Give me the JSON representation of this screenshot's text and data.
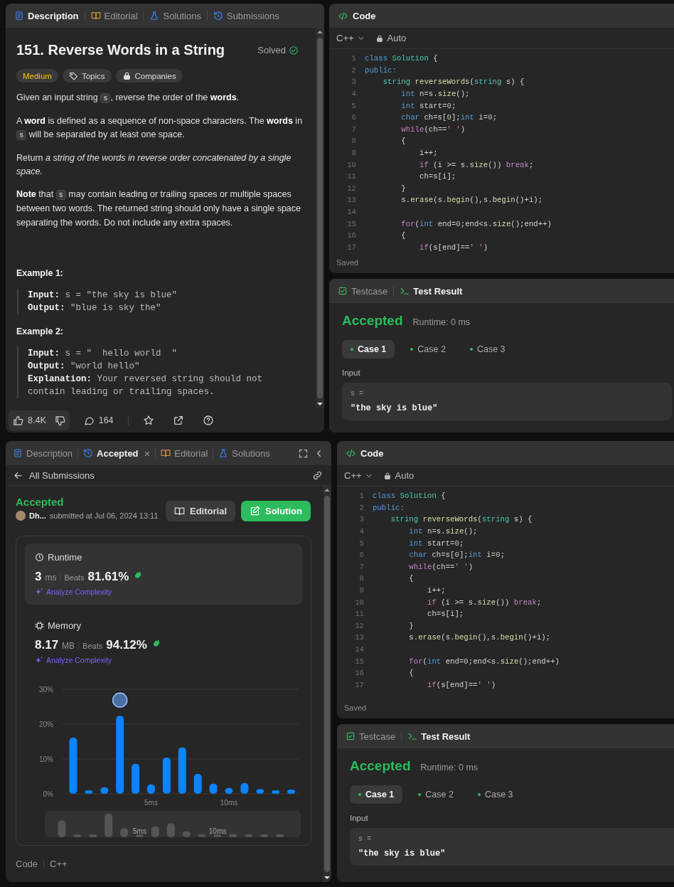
{
  "top": {
    "description_panel": {
      "tabs": [
        {
          "kind": "description",
          "label": "Description",
          "selected": true
        },
        {
          "kind": "editorial",
          "label": "Editorial",
          "selected": false
        },
        {
          "kind": "solutions",
          "label": "Solutions",
          "selected": false
        },
        {
          "kind": "submissions",
          "label": "Submissions",
          "selected": false
        }
      ],
      "title": "151. Reverse Words in a String",
      "status": "Solved",
      "tags": [
        {
          "kind": "difficulty",
          "label": "Medium"
        },
        {
          "kind": "topics",
          "label": "Topics"
        },
        {
          "kind": "companies",
          "label": "Companies"
        }
      ],
      "paragraphs": [
        [
          {
            "kind": "text",
            "text": "Given an input string "
          },
          {
            "kind": "code",
            "text": "s"
          },
          {
            "kind": "text",
            "text": ", reverse the order of the **words**."
          }
        ],
        [
          {
            "kind": "text",
            "text": "A **word** is defined as a sequence of non-space characters. The **words** in "
          },
          {
            "kind": "code",
            "text": "s"
          },
          {
            "kind": "text",
            "text": " will be separated by at least one space."
          }
        ],
        [
          {
            "kind": "text",
            "text": "Return *a string of the words in reverse order concatenated by a single space.*"
          }
        ],
        [
          {
            "kind": "text",
            "text": "**Note** that "
          },
          {
            "kind": "code",
            "text": "s"
          },
          {
            "kind": "text",
            "text": " may contain leading or trailing spaces or multiple spaces between two words. The returned string should only have a single space separating the words. Do not include any extra spaces."
          }
        ]
      ],
      "examples": [
        {
          "title": "Example 1:",
          "lines": [
            "**Input:** s = \"the sky is blue\"",
            "**Output:** \"blue is sky the\""
          ]
        },
        {
          "title": "Example 2:",
          "lines": [
            "**Input:** s = \"  hello world  \"",
            "**Output:** \"world hello\"",
            "**Explanation:** Your reversed string should not contain leading or trailing spaces."
          ]
        }
      ],
      "likes": "8.4K",
      "comments": "164"
    },
    "code_panel": {
      "title": "Code",
      "language": "C++",
      "mode": "Auto",
      "status": "Saved",
      "lines": [
        {
          "n": "1",
          "tokens": [
            {
              "kind": "keyword",
              "text": "class "
            },
            {
              "kind": "type",
              "text": "Solution"
            },
            {
              "kind": "plain",
              "text": " {"
            }
          ]
        },
        {
          "n": "2",
          "tokens": [
            {
              "kind": "keyword",
              "text": "public:"
            }
          ]
        },
        {
          "n": "3",
          "tokens": [
            {
              "kind": "type",
              "text": "    string "
            },
            {
              "kind": "function",
              "text": "reverseWords"
            },
            {
              "kind": "plain",
              "text": "("
            },
            {
              "kind": "type",
              "text": "string"
            },
            {
              "kind": "plain",
              "text": " s) {"
            }
          ]
        },
        {
          "n": "4",
          "tokens": [
            {
              "kind": "keyword",
              "text": "        int"
            },
            {
              "kind": "plain",
              "text": " n=s."
            },
            {
              "kind": "function",
              "text": "size"
            },
            {
              "kind": "plain",
              "text": "();"
            }
          ]
        },
        {
          "n": "5",
          "tokens": [
            {
              "kind": "keyword",
              "text": "        int"
            },
            {
              "kind": "plain",
              "text": " start="
            },
            {
              "kind": "number",
              "text": "0"
            },
            {
              "kind": "plain",
              "text": ";"
            }
          ]
        },
        {
          "n": "6",
          "tokens": [
            {
              "kind": "keyword",
              "text": "        char"
            },
            {
              "kind": "plain",
              "text": " ch=s["
            },
            {
              "kind": "number",
              "text": "0"
            },
            {
              "kind": "plain",
              "text": "];"
            },
            {
              "kind": "keyword",
              "text": "int"
            },
            {
              "kind": "plain",
              "text": " i="
            },
            {
              "kind": "number",
              "text": "0"
            },
            {
              "kind": "plain",
              "text": ";"
            }
          ]
        },
        {
          "n": "7",
          "tokens": [
            {
              "kind": "control",
              "text": "        while"
            },
            {
              "kind": "plain",
              "text": "(ch=="
            },
            {
              "kind": "string",
              "text": "' '"
            },
            {
              "kind": "plain",
              "text": ")"
            }
          ]
        },
        {
          "n": "8",
          "tokens": [
            {
              "kind": "plain",
              "text": "        {"
            }
          ]
        },
        {
          "n": "9",
          "tokens": [
            {
              "kind": "plain",
              "text": "            i++;"
            }
          ]
        },
        {
          "n": "10",
          "tokens": [
            {
              "kind": "control",
              "text": "            if"
            },
            {
              "kind": "plain",
              "text": " (i >= s."
            },
            {
              "kind": "function",
              "text": "size"
            },
            {
              "kind": "plain",
              "text": "()) "
            },
            {
              "kind": "control",
              "text": "break"
            },
            {
              "kind": "plain",
              "text": ";"
            }
          ]
        },
        {
          "n": "11",
          "tokens": [
            {
              "kind": "plain",
              "text": "            ch=s[i];"
            }
          ]
        },
        {
          "n": "12",
          "tokens": [
            {
              "kind": "plain",
              "text": "        }"
            }
          ]
        },
        {
          "n": "13",
          "tokens": [
            {
              "kind": "plain",
              "text": "        s."
            },
            {
              "kind": "function",
              "text": "erase"
            },
            {
              "kind": "plain",
              "text": "(s."
            },
            {
              "kind": "function",
              "text": "begin"
            },
            {
              "kind": "plain",
              "text": "(),s."
            },
            {
              "kind": "function",
              "text": "begin"
            },
            {
              "kind": "plain",
              "text": "()+i);"
            }
          ]
        },
        {
          "n": "14"
        },
        {
          "n": "15",
          "tokens": [
            {
              "kind": "control",
              "text": "        for"
            },
            {
              "kind": "plain",
              "text": "("
            },
            {
              "kind": "keyword",
              "text": "int"
            },
            {
              "kind": "plain",
              "text": " end="
            },
            {
              "kind": "number",
              "text": "0"
            },
            {
              "kind": "plain",
              "text": ";end<s."
            },
            {
              "kind": "function",
              "text": "size"
            },
            {
              "kind": "plain",
              "text": "();end++)"
            }
          ]
        },
        {
          "n": "16",
          "tokens": [
            {
              "kind": "plain",
              "text": "        {"
            }
          ]
        },
        {
          "n": "17",
          "tokens": [
            {
              "kind": "control",
              "text": "            if"
            },
            {
              "kind": "plain",
              "text": "(s[end]=="
            },
            {
              "kind": "string",
              "text": "' '"
            },
            {
              "kind": "plain",
              "text": ")"
            }
          ]
        }
      ]
    },
    "result_panel": {
      "tabs": [
        {
          "kind": "testcase",
          "label": "Testcase",
          "selected": false
        },
        {
          "kind": "result",
          "label": "Test Result",
          "selected": true
        }
      ],
      "verdict": "Accepted",
      "runtime": "Runtime: 0 ms",
      "cases": [
        {
          "label": "Case 1",
          "selected": true,
          "passed": true
        },
        {
          "label": "Case 2",
          "selected": false,
          "passed": true
        },
        {
          "label": "Case 3",
          "selected": false,
          "passed": true
        }
      ],
      "input_label": "Input",
      "inputs": [
        {
          "name": "s =",
          "value": "\"the sky is blue\""
        }
      ]
    }
  },
  "bottom": {
    "submission_panel": {
      "tabs": [
        {
          "kind": "description",
          "label": "Description",
          "selected": false
        },
        {
          "kind": "submissions",
          "label": "Accepted",
          "selected": true,
          "close": "×"
        },
        {
          "kind": "editorial",
          "label": "Editorial",
          "selected": false
        },
        {
          "kind": "solutions",
          "label": "Solutions",
          "selected": false
        }
      ],
      "back": "All Submissions",
      "verdict": "Accepted",
      "user": "Dh...",
      "submitted": "submitted at Jul 06, 2024 13:11",
      "buttons": [
        {
          "kind": "editorial",
          "label": "Editorial"
        },
        {
          "kind": "solution",
          "label": "Solution"
        }
      ],
      "stats": [
        {
          "kind": "runtime",
          "label": "Runtime",
          "value": "3",
          "unit": "ms",
          "beats_label": "Beats",
          "beats": "81.61%",
          "analyze": "Analyze Complexity",
          "selected": true
        },
        {
          "kind": "memory",
          "label": "Memory",
          "value": "8.17",
          "unit": "MB",
          "beats_label": "Beats",
          "beats": "94.12%",
          "analyze": "Analyze Complexity",
          "selected": false
        }
      ],
      "chart_data": {
        "type": "bar",
        "series": [
          {
            "color": "#0a84ff",
            "values": [
              16.1,
              1.0,
              1.9,
              22.4,
              8.6,
              2.7,
              10.4,
              13.3,
              5.7,
              2.9,
              1.7,
              3.1,
              1.4,
              1.0,
              1.2
            ]
          }
        ],
        "yticks": [
          {
            "value": 0,
            "label": "0%"
          },
          {
            "value": 10,
            "label": "10%"
          },
          {
            "value": 20,
            "label": "20%"
          },
          {
            "value": 30,
            "label": "30%"
          }
        ],
        "ylim": [
          0,
          30
        ]
      },
      "x_axis_labels": [
        "5ms",
        "10ms"
      ],
      "overview_labels": [
        "5ms",
        "10ms"
      ],
      "footer": [
        "Code",
        "C++"
      ]
    },
    "code_panel": {
      "title": "Code",
      "language": "C++",
      "mode": "Auto",
      "status": "Saved",
      "lines": [
        {
          "n": "1",
          "tokens": [
            {
              "kind": "keyword",
              "text": "class "
            },
            {
              "kind": "type",
              "text": "Solution"
            },
            {
              "kind": "plain",
              "text": " {"
            }
          ]
        },
        {
          "n": "2",
          "tokens": [
            {
              "kind": "keyword",
              "text": "public:"
            }
          ]
        },
        {
          "n": "3",
          "tokens": [
            {
              "kind": "type",
              "text": "    string "
            },
            {
              "kind": "function",
              "text": "reverseWords"
            },
            {
              "kind": "plain",
              "text": "("
            },
            {
              "kind": "type",
              "text": "string"
            },
            {
              "kind": "plain",
              "text": " s) {"
            }
          ]
        },
        {
          "n": "4",
          "tokens": [
            {
              "kind": "keyword",
              "text": "        int"
            },
            {
              "kind": "plain",
              "text": " n=s."
            },
            {
              "kind": "function",
              "text": "size"
            },
            {
              "kind": "plain",
              "text": "();"
            }
          ]
        },
        {
          "n": "5",
          "tokens": [
            {
              "kind": "keyword",
              "text": "        int"
            },
            {
              "kind": "plain",
              "text": " start="
            },
            {
              "kind": "number",
              "text": "0"
            },
            {
              "kind": "plain",
              "text": ";"
            }
          ]
        },
        {
          "n": "6",
          "tokens": [
            {
              "kind": "keyword",
              "text": "        char"
            },
            {
              "kind": "plain",
              "text": " ch=s["
            },
            {
              "kind": "number",
              "text": "0"
            },
            {
              "kind": "plain",
              "text": "];"
            },
            {
              "kind": "keyword",
              "text": "int"
            },
            {
              "kind": "plain",
              "text": " i="
            },
            {
              "kind": "number",
              "text": "0"
            },
            {
              "kind": "plain",
              "text": ";"
            }
          ]
        },
        {
          "n": "7",
          "tokens": [
            {
              "kind": "control",
              "text": "        while"
            },
            {
              "kind": "plain",
              "text": "(ch=="
            },
            {
              "kind": "string",
              "text": "' '"
            },
            {
              "kind": "plain",
              "text": ")"
            }
          ]
        },
        {
          "n": "8",
          "tokens": [
            {
              "kind": "plain",
              "text": "        {"
            }
          ]
        },
        {
          "n": "9",
          "tokens": [
            {
              "kind": "plain",
              "text": "            i++;"
            }
          ]
        },
        {
          "n": "10",
          "tokens": [
            {
              "kind": "control",
              "text": "            if"
            },
            {
              "kind": "plain",
              "text": " (i >= s."
            },
            {
              "kind": "function",
              "text": "size"
            },
            {
              "kind": "plain",
              "text": "()) "
            },
            {
              "kind": "control",
              "text": "break"
            },
            {
              "kind": "plain",
              "text": ";"
            }
          ]
        },
        {
          "n": "11",
          "tokens": [
            {
              "kind": "plain",
              "text": "            ch=s[i];"
            }
          ]
        },
        {
          "n": "12",
          "tokens": [
            {
              "kind": "plain",
              "text": "        }"
            }
          ]
        },
        {
          "n": "13",
          "tokens": [
            {
              "kind": "plain",
              "text": "        s."
            },
            {
              "kind": "function",
              "text": "erase"
            },
            {
              "kind": "plain",
              "text": "(s."
            },
            {
              "kind": "function",
              "text": "begin"
            },
            {
              "kind": "plain",
              "text": "(),s."
            },
            {
              "kind": "function",
              "text": "begin"
            },
            {
              "kind": "plain",
              "text": "()+i);"
            }
          ]
        },
        {
          "n": "14"
        },
        {
          "n": "15",
          "tokens": [
            {
              "kind": "control",
              "text": "        for"
            },
            {
              "kind": "plain",
              "text": "("
            },
            {
              "kind": "keyword",
              "text": "int"
            },
            {
              "kind": "plain",
              "text": " end="
            },
            {
              "kind": "number",
              "text": "0"
            },
            {
              "kind": "plain",
              "text": ";end<s."
            },
            {
              "kind": "function",
              "text": "size"
            },
            {
              "kind": "plain",
              "text": "();end++)"
            }
          ]
        },
        {
          "n": "16",
          "tokens": [
            {
              "kind": "plain",
              "text": "        {"
            }
          ]
        },
        {
          "n": "17",
          "tokens": [
            {
              "kind": "control",
              "text": "            if"
            },
            {
              "kind": "plain",
              "text": "(s[end]=="
            },
            {
              "kind": "string",
              "text": "' '"
            },
            {
              "kind": "plain",
              "text": ")"
            }
          ]
        }
      ]
    },
    "result_panel": {
      "tabs": [
        {
          "kind": "testcase",
          "label": "Testcase",
          "selected": false
        },
        {
          "kind": "result",
          "label": "Test Result",
          "selected": true
        }
      ],
      "verdict": "Accepted",
      "runtime": "Runtime: 0 ms",
      "cases": [
        {
          "label": "Case 1",
          "selected": true,
          "passed": true
        },
        {
          "label": "Case 2",
          "selected": false,
          "passed": true
        },
        {
          "label": "Case 3",
          "selected": false,
          "passed": true
        }
      ],
      "input_label": "Input",
      "inputs": [
        {
          "name": "s =",
          "value": "\"the sky is blue\""
        }
      ]
    }
  }
}
